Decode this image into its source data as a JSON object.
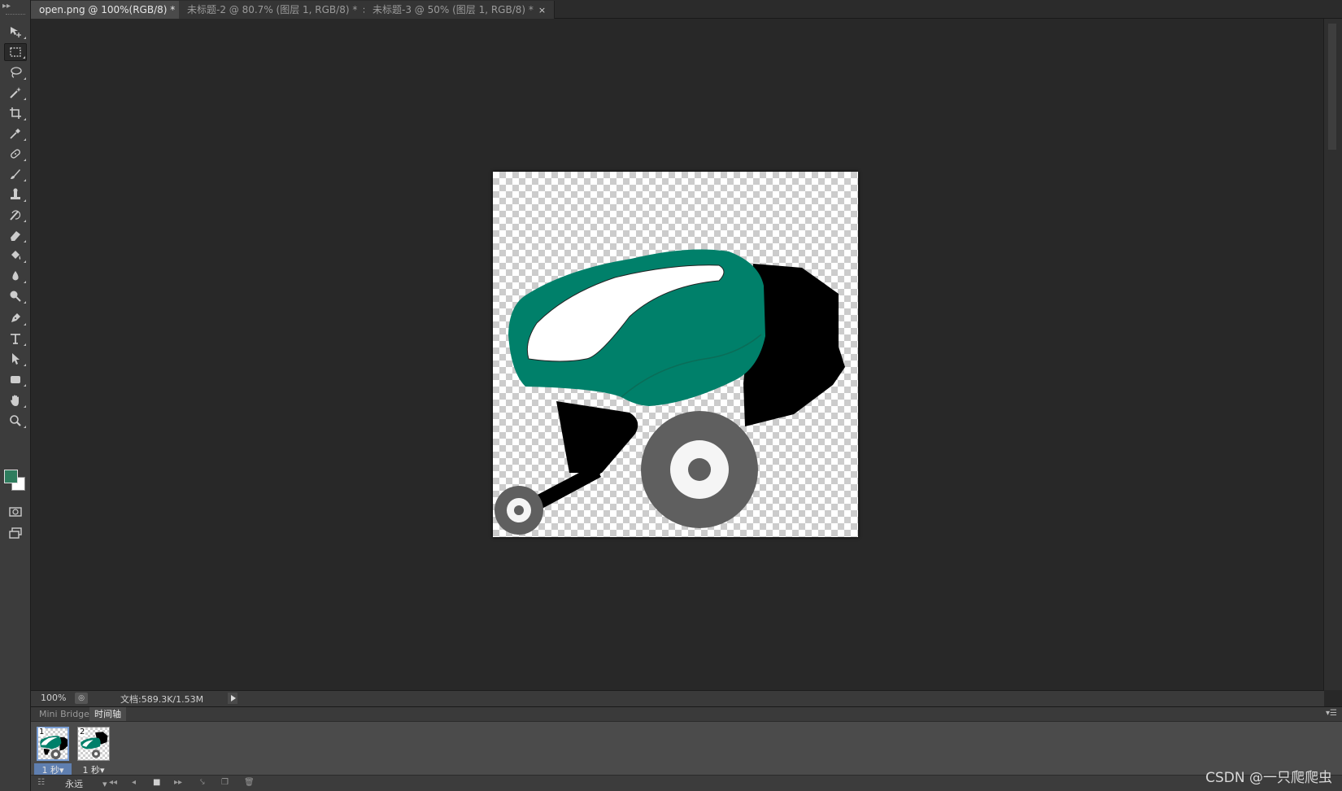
{
  "tabs": [
    {
      "label": "open.png @ 100%(RGB/8) *",
      "close": "×"
    },
    {
      "label": "未标题-2 @ 80.7% (图层 1, RGB/8) *",
      "close": "×"
    },
    {
      "label": "未标题-3 @ 50% (图层 1, RGB/8) *",
      "close": "×"
    }
  ],
  "toolbox": {
    "grip": "▸▸",
    "tools": [
      {
        "name": "move-tool-icon",
        "glyph": "move"
      },
      {
        "name": "marquee-tool-icon",
        "glyph": "marquee"
      },
      {
        "name": "lasso-tool-icon",
        "glyph": "lasso"
      },
      {
        "name": "magic-wand-tool-icon",
        "glyph": "wand"
      },
      {
        "name": "crop-tool-icon",
        "glyph": "crop"
      },
      {
        "name": "eyedropper-tool-icon",
        "glyph": "eyedropper"
      },
      {
        "name": "healing-brush-tool-icon",
        "glyph": "heal"
      },
      {
        "name": "brush-tool-icon",
        "glyph": "brush"
      },
      {
        "name": "clone-stamp-tool-icon",
        "glyph": "stamp"
      },
      {
        "name": "history-brush-tool-icon",
        "glyph": "history"
      },
      {
        "name": "eraser-tool-icon",
        "glyph": "eraser"
      },
      {
        "name": "paint-bucket-tool-icon",
        "glyph": "bucket"
      },
      {
        "name": "blur-tool-icon",
        "glyph": "drop"
      },
      {
        "name": "dodge-tool-icon",
        "glyph": "dodge"
      },
      {
        "name": "pen-tool-icon",
        "glyph": "pen"
      },
      {
        "name": "type-tool-icon",
        "glyph": "type"
      },
      {
        "name": "path-selection-tool-icon",
        "glyph": "arrow"
      },
      {
        "name": "shape-tool-icon",
        "glyph": "rect"
      },
      {
        "name": "hand-tool-icon",
        "glyph": "hand"
      },
      {
        "name": "zoom-tool-icon",
        "glyph": "zoom"
      }
    ],
    "foreground_color": "#2e7d5e",
    "background_color": "#ffffff"
  },
  "status": {
    "zoom": "100%",
    "doc_info": "文档:589.3K/1.53M"
  },
  "panel": {
    "tabs": [
      "Mini Bridge",
      "时间轴"
    ],
    "active_tab": "时间轴",
    "frames": [
      {
        "number": "1",
        "delay": "1 秒▾"
      },
      {
        "number": "2",
        "delay": "1 秒▾"
      }
    ],
    "loop": "永远",
    "loop_arrow": "▾"
  },
  "colors": {
    "mower_green": "#00806a",
    "mower_black": "#000000",
    "wheel_gray": "#5f5f5f"
  },
  "watermark": "CSDN @一只爬爬虫"
}
